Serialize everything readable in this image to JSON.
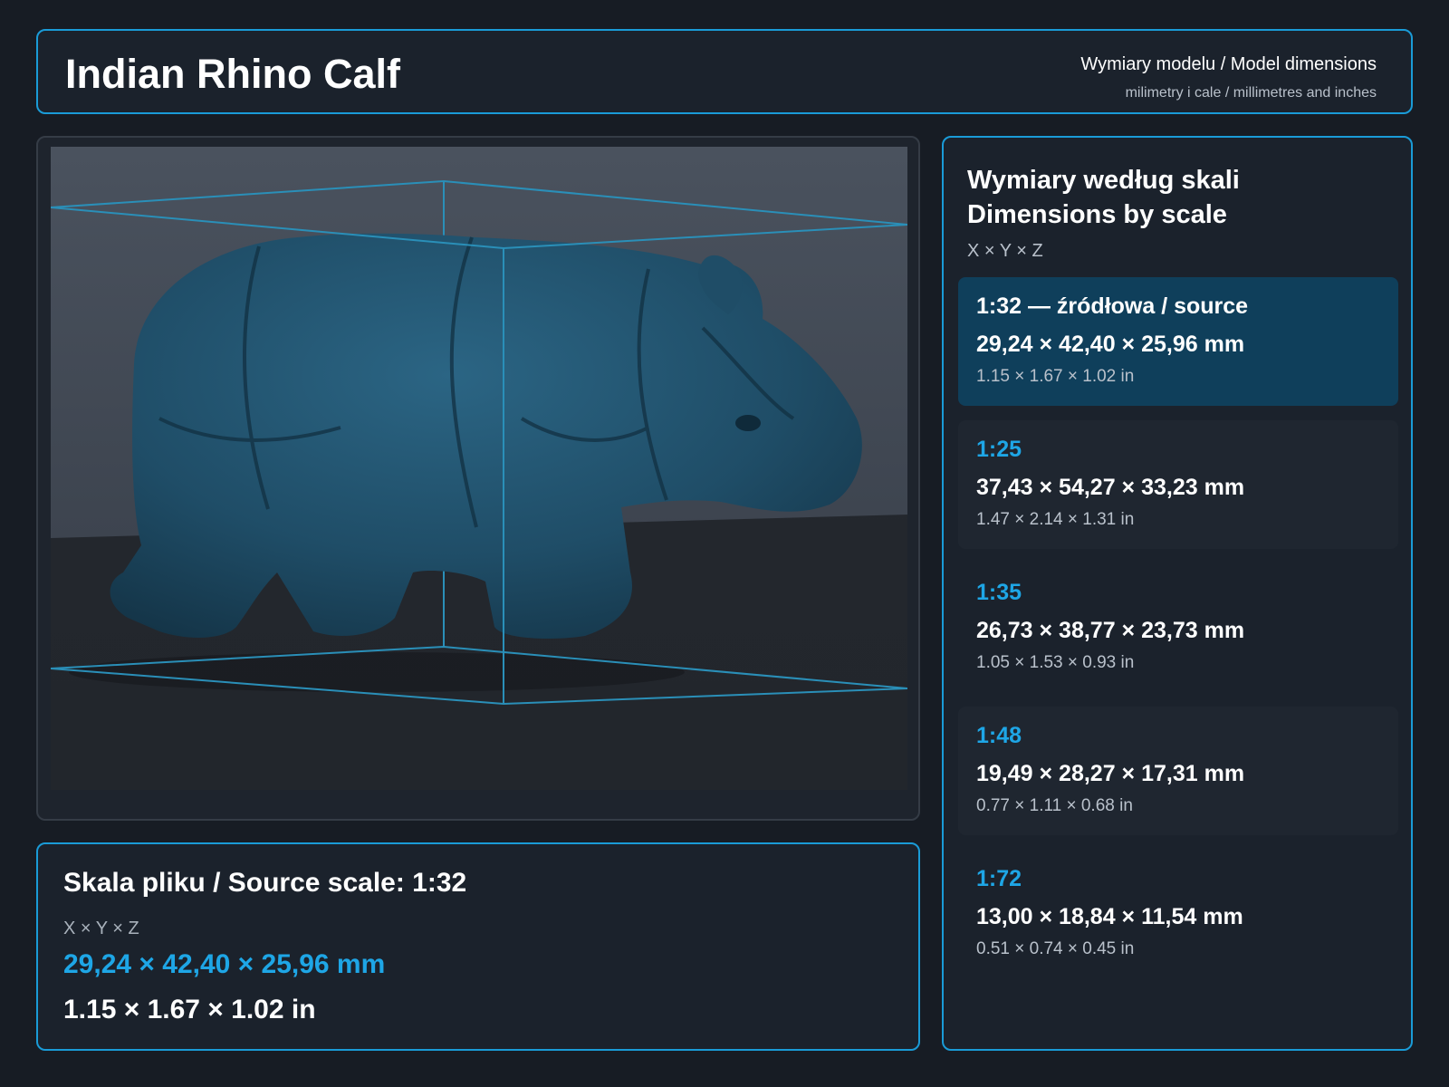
{
  "header": {
    "title": "Indian Rhino Calf",
    "subtitle": "Wymiary modelu / Model dimensions",
    "units_note": "milimetry i cale / millimetres and inches"
  },
  "viewer": {
    "image": "3D render of rhino calf model with bounding box",
    "model_color": "#1d4a63",
    "box_color": "#2a8fb8"
  },
  "source": {
    "title": "Skala pliku / Source scale: 1:32",
    "axes": "X × Y × Z",
    "mm": "29,24 × 42,40 × 25,96 mm",
    "inches": "1.15 × 1.67 × 1.02 in"
  },
  "scales_panel": {
    "title_pl": "Wymiary według skali",
    "title_en": "Dimensions by scale",
    "axes": "X × Y × Z",
    "items": [
      {
        "scale": "1:32  —  źródłowa / source",
        "mm": "29,24 × 42,40 × 25,96 mm",
        "inches": "1.15 × 1.67 × 1.02 in",
        "active": true
      },
      {
        "scale": "1:25",
        "mm": "37,43 × 54,27 × 33,23 mm",
        "inches": "1.47 × 2.14 × 1.31 in",
        "active": false
      },
      {
        "scale": "1:35",
        "mm": "26,73 × 38,77 × 23,73 mm",
        "inches": "1.05 × 1.53 × 0.93 in",
        "active": false
      },
      {
        "scale": "1:48",
        "mm": "19,49 × 28,27 × 17,31 mm",
        "inches": "0.77 × 1.11 × 0.68 in",
        "active": false
      },
      {
        "scale": "1:72",
        "mm": "13,00 × 18,84 × 11,54 mm",
        "inches": "0.51 × 0.74 × 0.45 in",
        "active": false
      }
    ]
  },
  "colors": {
    "accent": "#1a9bd7",
    "accent_text": "#1ea6e6",
    "background": "#171c24",
    "active_card": "#0f3f5b"
  }
}
